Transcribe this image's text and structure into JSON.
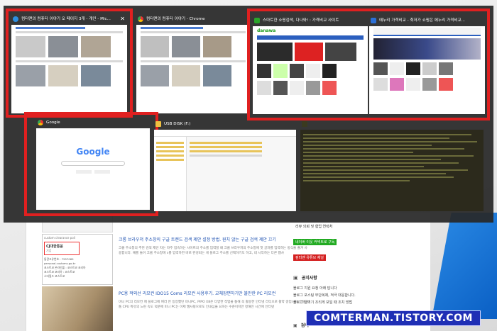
{
  "windows": [
    {
      "title": "컴터맨의 컴퓨터 이야기 오 페이지 3개 - 개인 - Mic...",
      "close": "✕",
      "icon": "edge-icon"
    },
    {
      "title": "컴터맨의 컴퓨터 이야기 - Chrome",
      "icon": "chrome-icon"
    },
    {
      "title": "스마트한 쇼핑검색, 다나와! : 가격비교 사이트",
      "icon": "danawa-icon",
      "logo": "danawa"
    },
    {
      "title": "에누리 가격비교 - 최저가 쇼핑은 에누리 가격비교...",
      "icon": "enuri-icon"
    },
    {
      "title": "Google",
      "icon": "chrome-icon",
      "logo": "Google"
    },
    {
      "title": "USB DISK (F:)",
      "icon": "folder-icon"
    },
    {
      "title": "",
      "icon": "terminal-icon"
    }
  ],
  "background_page": {
    "post1_title": "크롬 브라우저 주소창의 구글 트렌드 검색 제안 설정 방법. 원치 않는 구글 검색 제안 끄기",
    "post1_text": "크롬 주소창의 추천 검색 제안 자는 자주 접속하는 사이트의 주소를 입력할 때 크롬 브라우저의 주소창에 첫 글자를 입력하는 방식을 즐겨 사용합니다. 예를 들어 크롬 주소창에 s를 입력하면 바로 완성되는 게 블로그 주소를 선택하기도 하고, 네 시작하는 다른 웹사",
    "post2_title": "PC용 적외선 리모컨 IDO15 Coms 리모컨 사용후기. 교체장면하기만 불만한 PC 리모컨",
    "post2_text": "미니 PC의 리모컨 제 블로그에 여러 번 등장했던 미니PC, PIPO X8은 다양한 작업을 통해 꼭 활용한 인터넷 라디오로 활약 중입니다. 인텔 아톰 CPU 특유의 느린 속도 덕분에 미니 PC는 이제 웹사핑으로도 인내심을 요하는 수준이지만 정해진 시간에 인터넷",
    "thumb_top": "custom clearance poli",
    "thumb_brand": "CJ대한통운",
    "thumb_sub": "기업",
    "thumb_lines": [
      "통관고유번호 : 7557069",
      "personal.customs.go.kr",
      "코스트코 온라인몰 : 코스트코 코리아",
      "코스트코 코리아 : 코스트코",
      "스타필드 코스트코"
    ]
  },
  "sidebar": {
    "badges": [
      {
        "label": "리뷰 의뢰 및 협업 연락처",
        "color": "#ffffff",
        "text_color": "#333333"
      },
      {
        "label": "네이버 이웃 커넥트로 구독",
        "color": "#22aa22",
        "text_color": "#ffffff"
      },
      {
        "label": "컴터맨 유튜브 채널",
        "color": "#d42020",
        "text_color": "#ffffff"
      }
    ],
    "notice_title": "공지사항",
    "notices": [
      "블로그 지원 요청 아래 답니다",
      "블로그 포스팅 무단복제, 적극 대응합니다.",
      "블로그 글의기 조리게 보일 때 조치 방법"
    ],
    "bottom_label": "검색"
  },
  "watermark": "COMTERMAN.TISTORY.COM",
  "colors": {
    "selection": "#e02020",
    "switcher_bg": "#282828",
    "accent": "#1f2fb5"
  }
}
